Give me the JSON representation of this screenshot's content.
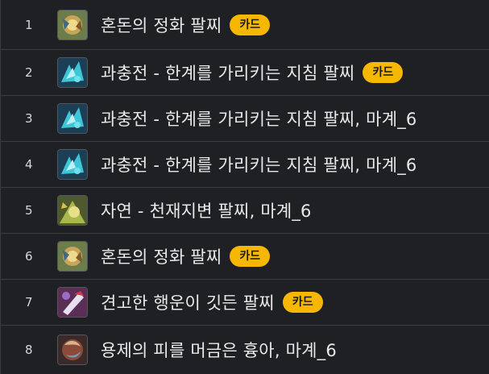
{
  "items": [
    {
      "index": "1",
      "name": "혼돈의 정화 팔찌",
      "badge": "카드",
      "icon": "chaos-purify-icon"
    },
    {
      "index": "2",
      "name": "과충전 - 한계를 가리키는 지침 팔찌",
      "badge": "카드",
      "icon": "overcharge-icon"
    },
    {
      "index": "3",
      "name": "과충전 - 한계를 가리키는 지침 팔찌, 마계_6",
      "badge": "",
      "icon": "overcharge-icon"
    },
    {
      "index": "4",
      "name": "과충전 - 한계를 가리키는 지침 팔찌, 마계_6",
      "badge": "",
      "icon": "overcharge-icon"
    },
    {
      "index": "5",
      "name": "자연 - 천재지변 팔찌, 마계_6",
      "badge": "",
      "icon": "nature-icon"
    },
    {
      "index": "6",
      "name": "혼돈의 정화 팔찌",
      "badge": "카드",
      "icon": "chaos-purify-icon"
    },
    {
      "index": "7",
      "name": "견고한 행운이 깃든 팔찌",
      "badge": "카드",
      "icon": "solid-luck-icon"
    },
    {
      "index": "8",
      "name": "용제의 피를 머금은 흉아, 마계_6",
      "badge": "",
      "icon": "dragon-blood-icon"
    }
  ],
  "colors": {
    "background": "#1f2024",
    "badge": "#f5b700",
    "divider": "#3c3d42",
    "text": "#e9e9ea"
  }
}
